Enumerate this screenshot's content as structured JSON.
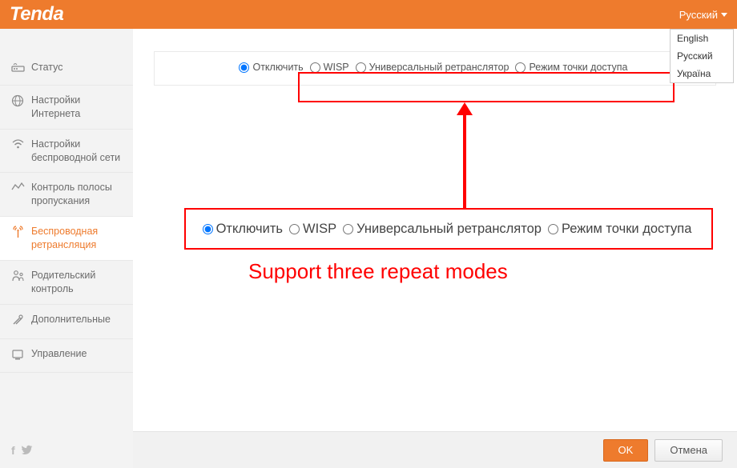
{
  "header": {
    "brand": "Tenda",
    "language_current": "Русский",
    "language_options": [
      "English",
      "Русский",
      "Україна"
    ]
  },
  "sidebar": {
    "items": [
      {
        "label": "Статус",
        "icon": "status-icon"
      },
      {
        "label": "Настройки Интернета",
        "icon": "globe-icon"
      },
      {
        "label": "Настройки беспроводной сети",
        "icon": "wifi-icon"
      },
      {
        "label": "Контроль полосы пропускания",
        "icon": "bandwidth-icon"
      },
      {
        "label": "Беспроводная ретрансляция",
        "icon": "antenna-icon",
        "active": true
      },
      {
        "label": "Родительский контроль",
        "icon": "parental-icon"
      },
      {
        "label": "Дополнительные",
        "icon": "tools-icon"
      },
      {
        "label": "Управление",
        "icon": "manage-icon"
      }
    ]
  },
  "modes": {
    "options": [
      {
        "label": "Отключить",
        "checked": true
      },
      {
        "label": "WISP",
        "checked": false
      },
      {
        "label": "Универсальный ретранслятор",
        "checked": false
      },
      {
        "label": "Режим точки доступа",
        "checked": false
      }
    ]
  },
  "annotation": "Support three repeat modes",
  "footer": {
    "ok": "OK",
    "cancel": "Отмена"
  }
}
